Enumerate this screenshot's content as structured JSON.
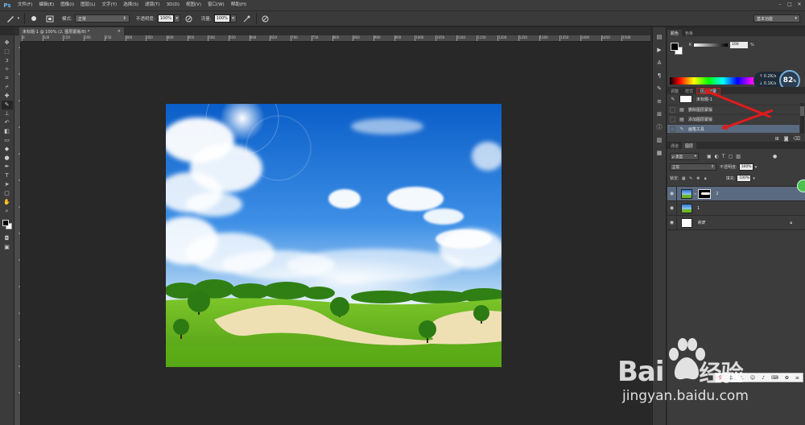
{
  "app": {
    "logo": "Ps"
  },
  "menu": [
    "文件(F)",
    "编辑(E)",
    "图像(I)",
    "图层(L)",
    "文字(Y)",
    "选择(S)",
    "滤镜(T)",
    "3D(D)",
    "视图(V)",
    "窗口(W)",
    "帮助(H)"
  ],
  "window_controls": [
    "–",
    "□",
    "✕"
  ],
  "options": {
    "mode_label": "模式:",
    "mode_value": "正常",
    "opacity_label": "不透明度:",
    "opacity_value": "100%",
    "flow_label": "流量:",
    "flow_value": "100%",
    "workspace": "基本功能"
  },
  "document": {
    "tab_title": "未标题-1 @ 100% (2, 图层蒙版/8) *",
    "close": "×"
  },
  "ruler": {
    "top": [
      "0",
      "100",
      "150",
      "200",
      "250",
      "300",
      "350",
      "400",
      "450",
      "500",
      "550",
      "600",
      "650",
      "700",
      "750",
      "800",
      "850",
      "900",
      "950",
      "1000",
      "1050",
      "1100",
      "1150",
      "1200",
      "1250",
      "1300",
      "1350",
      "1400",
      "1450",
      "1500"
    ],
    "left": [
      "5",
      "0",
      "5",
      "0",
      "5",
      "0",
      "5",
      "0",
      "5",
      "0",
      "5",
      "0",
      "5",
      "0"
    ]
  },
  "panels": {
    "color_tabs": [
      "颜色",
      "色板"
    ],
    "k_label": "K",
    "k_value": "100",
    "k_unit": "%",
    "history_tabs": [
      "调整",
      "样式",
      "历史记录"
    ],
    "history": {
      "snapshot": "未标题-1",
      "items": [
        {
          "label": "删除图层蒙版",
          "icon": "layer-icon"
        },
        {
          "label": "添加图层蒙版",
          "icon": "layer-icon"
        },
        {
          "label": "画笔工具",
          "icon": "brush-icon"
        }
      ]
    },
    "layers_tabs": [
      "通道",
      "图层"
    ],
    "layers": {
      "filter": "ρ 类型",
      "blend_mode": "正常",
      "opacity_label": "不透明度:",
      "opacity_value": "100%",
      "lock_label": "锁定:",
      "fill_label": "填充:",
      "fill_value": "100%",
      "items": [
        {
          "name": "2",
          "italic": false,
          "selected": true
        },
        {
          "name": "1",
          "italic": false,
          "selected": false
        },
        {
          "name": "背景",
          "italic": true,
          "selected": false
        }
      ]
    }
  },
  "speed_widget": {
    "up": "0.2K/s",
    "down": "0.1K/s",
    "value": "82",
    "unit": "%"
  },
  "watermark": {
    "brand": "Bai",
    "brand_cn": "经验",
    "url": "jingyan.baidu.com"
  },
  "colors": {
    "accent_blue": "#6fb2e8",
    "selection": "#5a6a80",
    "annotation_red": "#e01b1b"
  }
}
